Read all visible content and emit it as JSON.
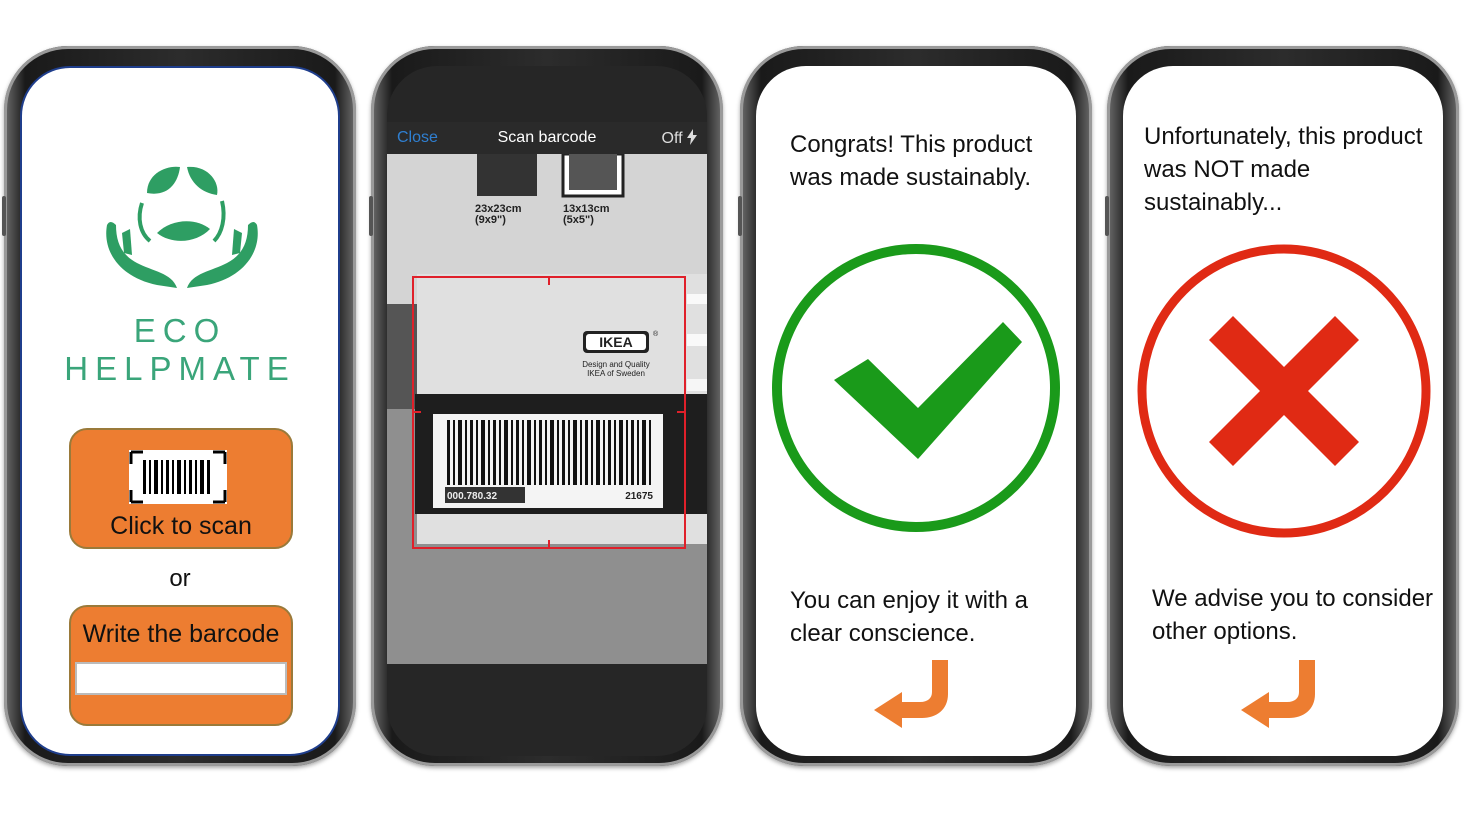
{
  "phone1": {
    "brand": "ECO HELPMATE",
    "scan_button_label": "Click to scan",
    "or_text": "or",
    "write_label": "Write the barcode",
    "barcode_input_value": "",
    "logo_icon": "leaf-hands-icon",
    "scan_icon": "barcode-icon",
    "accent_color": "#ed7d31",
    "brand_color": "#3aa57a"
  },
  "phone2": {
    "close_label": "Close",
    "title": "Scan barcode",
    "flash_label": "Off",
    "flash_icon": "lightning-icon",
    "frame1_size": "23x23cm",
    "frame1_size_in": "(9x9\")",
    "frame2_size": "13x13cm",
    "frame2_size_in": "(5x5\")",
    "brand_mark": "IKEA",
    "registered_mark": "®",
    "tagline_line1": "Design and Quality",
    "tagline_line2": "IKEA of Sweden",
    "barcode_left_number": "000.780.32",
    "barcode_right_number": "21675",
    "viewfinder_color": "#e0202a"
  },
  "phone3": {
    "message_top": "Congrats! This product was made sustainably.",
    "message_bottom": "You can enjoy it with a clear conscience.",
    "result_icon": "check-circle-icon",
    "result_color": "#1a9a1a",
    "back_icon": "return-arrow-icon"
  },
  "phone4": {
    "message_top": "Unfortunately, this product was NOT made sustainably...",
    "message_bottom": "We advise you to consider other options.",
    "result_icon": "x-circle-icon",
    "result_color": "#e02a14",
    "back_icon": "return-arrow-icon"
  }
}
